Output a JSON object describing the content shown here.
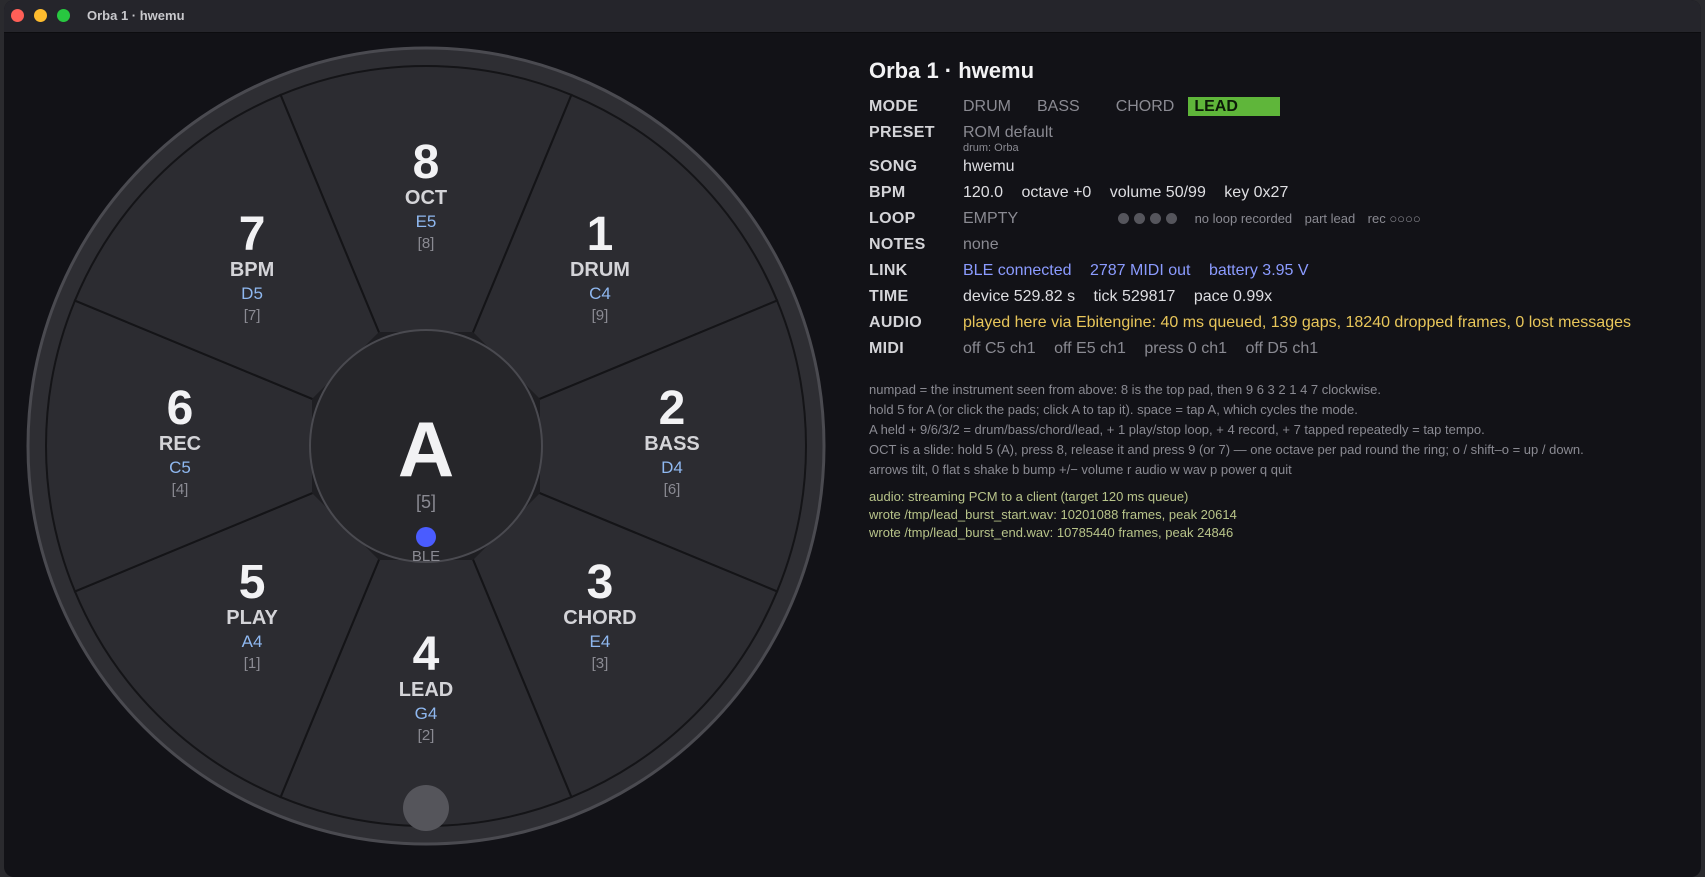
{
  "window": {
    "title": "Orba 1 · hwemu"
  },
  "center": {
    "letter": "A",
    "key": "[5]",
    "status": "BLE"
  },
  "pads": [
    {
      "num": "8",
      "name": "OCT",
      "note": "E5",
      "key": "[8]"
    },
    {
      "num": "1",
      "name": "DRUM",
      "note": "C4",
      "key": "[9]"
    },
    {
      "num": "2",
      "name": "BASS",
      "note": "D4",
      "key": "[6]"
    },
    {
      "num": "3",
      "name": "CHORD",
      "note": "E4",
      "key": "[3]"
    },
    {
      "num": "4",
      "name": "LEAD",
      "note": "G4",
      "key": "[2]"
    },
    {
      "num": "5",
      "name": "PLAY",
      "note": "A4",
      "key": "[1]"
    },
    {
      "num": "6",
      "name": "REC",
      "note": "C5",
      "key": "[4]"
    },
    {
      "num": "7",
      "name": "BPM",
      "note": "D5",
      "key": "[7]"
    }
  ],
  "info": {
    "title": "Orba 1 · hwemu",
    "labels": {
      "mode": "MODE",
      "preset": "PRESET",
      "song": "SONG",
      "bpm": "BPM",
      "loop": "LOOP",
      "notes": "NOTES",
      "link": "LINK",
      "time": "TIME",
      "audio": "AUDIO",
      "midi": "MIDI"
    },
    "modes": [
      "DRUM",
      "BASS",
      "CHORD",
      "LEAD"
    ],
    "active_mode": "LEAD",
    "preset": "ROM default",
    "preset_sub": "drum: Orba",
    "song": "hwemu",
    "bpm": {
      "tempo": "120.0",
      "octave": "octave +0",
      "volume": "volume 50/99",
      "key": "key 0x27"
    },
    "loop": {
      "state": "EMPTY",
      "desc": "no loop recorded",
      "part": "part lead",
      "rec": "rec ○○○○"
    },
    "notes": "none",
    "link": {
      "ble": "BLE connected",
      "midi": "2787 MIDI out",
      "battery": "battery 3.95 V"
    },
    "time": {
      "device": "device 529.82 s",
      "tick": "tick 529817",
      "pace": "pace 0.99x"
    },
    "audio": "played here via Ebitengine: 40 ms queued, 139 gaps, 18240 dropped frames, 0 lost messages",
    "midi": [
      "off C5 ch1",
      "off E5 ch1",
      "press 0 ch1",
      "off D5 ch1"
    ],
    "help": [
      "numpad = the instrument seen from above: 8 is the top pad, then 9 6 3 2 1 4 7 clockwise.",
      "hold 5 for A (or click the pads; click A to tap it).  space = tap A, which cycles the mode.",
      "A held + 9/6/3/2 = drum/bass/chord/lead,  + 1 play/stop loop,  + 4 record,  + 7 tapped repeatedly = tap tempo.",
      "OCT is a slide: hold 5 (A), press 8, release it and press 9 (or 7) — one octave per pad round the ring;  o / shift–o = up / down.",
      "arrows tilt, 0 flat   s shake   b bump   +/− volume   r audio   w wav   p power   q quit"
    ],
    "log": [
      "audio: streaming PCM to a client (target 120 ms queue)",
      "wrote /tmp/lead_burst_start.wav: 10201088 frames, peak 20614",
      "wrote /tmp/lead_burst_end.wav: 10785440 frames, peak 24846"
    ]
  },
  "colors": {
    "accent": "#5fb63a",
    "link": "#8b9bff",
    "audio": "#e8c65a",
    "ble_dot": "#4a5cff"
  }
}
